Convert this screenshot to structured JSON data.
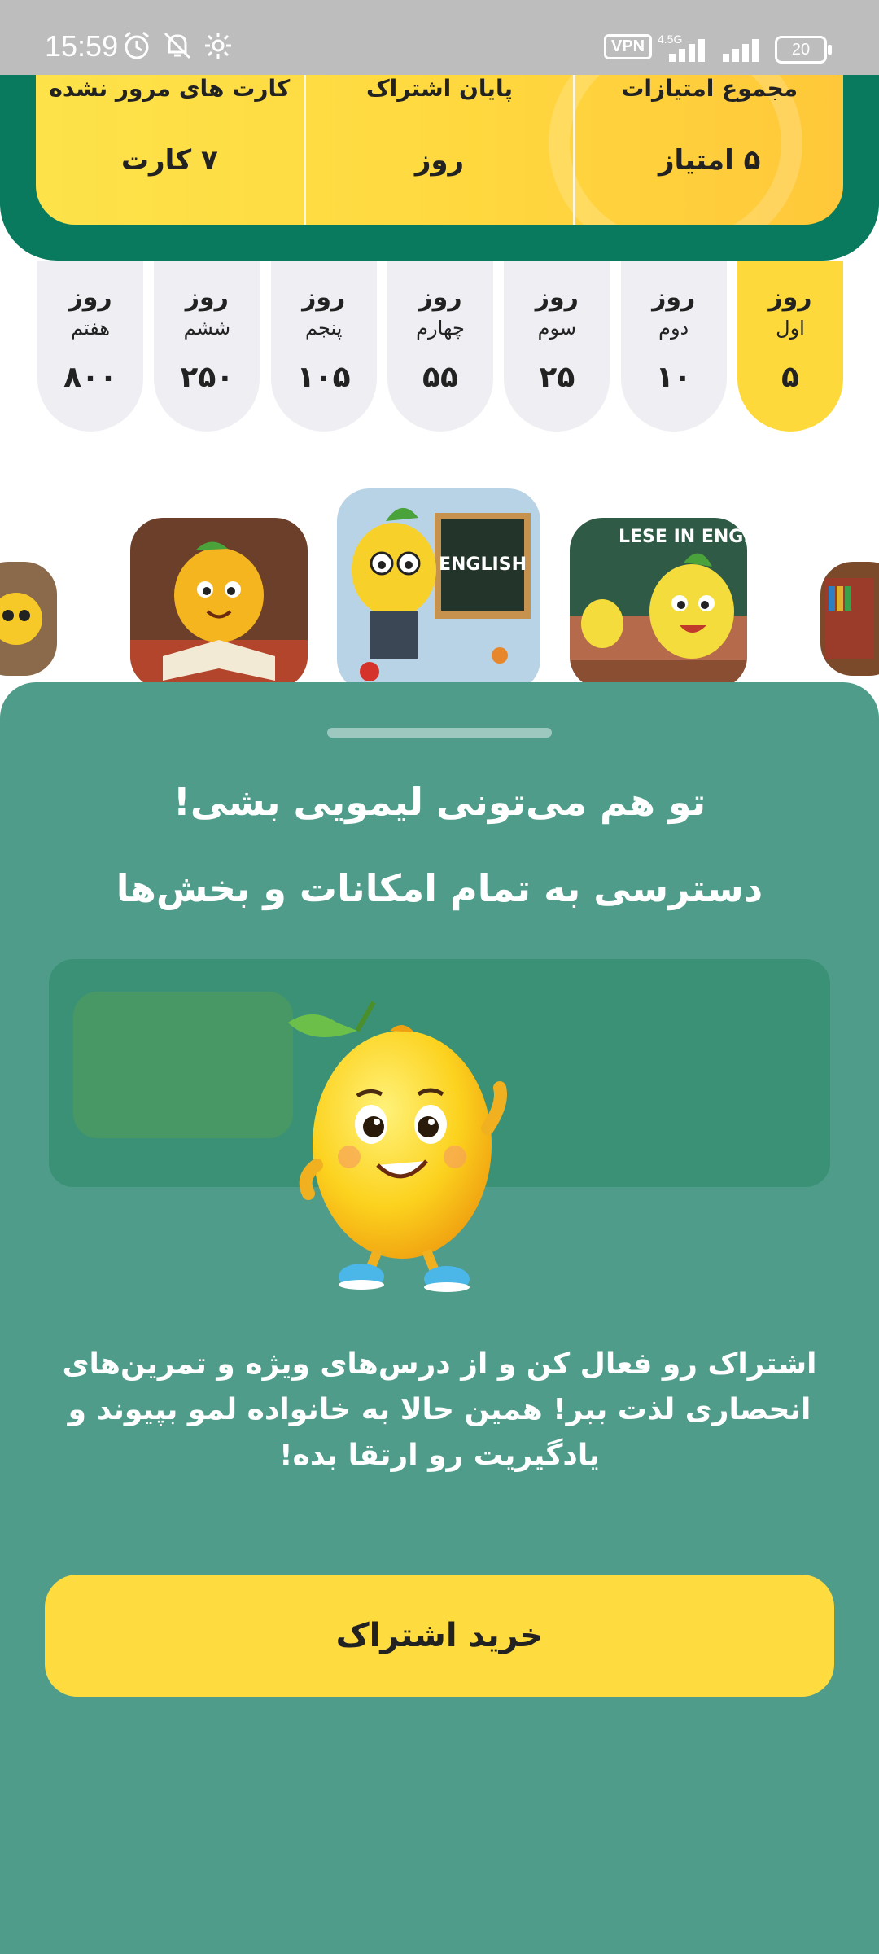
{
  "status_bar": {
    "time": "15:59",
    "vpn_label": "VPN",
    "network_type": "4.5G",
    "battery": "20",
    "icons": [
      "alarm-icon",
      "notifications-off-icon",
      "sync-icon",
      "signal-icon",
      "signal-icon-2",
      "battery-icon"
    ]
  },
  "stats": [
    {
      "label": "مجموع امتیازات",
      "value": "۵ امتیاز"
    },
    {
      "label": "پایان اشتراک",
      "value": "روز"
    },
    {
      "label": "کارت های مرور نشده",
      "value": "۷ کارت"
    }
  ],
  "days": [
    {
      "word": "روز",
      "ordinal": "اول",
      "value": "۵",
      "active": true
    },
    {
      "word": "روز",
      "ordinal": "دوم",
      "value": "۱۰",
      "active": false
    },
    {
      "word": "روز",
      "ordinal": "سوم",
      "value": "۲۵",
      "active": false
    },
    {
      "word": "روز",
      "ordinal": "چهارم",
      "value": "۵۵",
      "active": false
    },
    {
      "word": "روز",
      "ordinal": "پنجم",
      "value": "۱۰۵",
      "active": false
    },
    {
      "word": "روز",
      "ordinal": "ششم",
      "value": "۲۵۰",
      "active": false
    },
    {
      "word": "روز",
      "ordinal": "هفتم",
      "value": "۸۰۰",
      "active": false
    }
  ],
  "carousel": {
    "center_board_text": "ENGLISH",
    "right_board_text": "LESE IN ENGLISH"
  },
  "sheet": {
    "title": "تو هم می‌تونی لیمویی بشی!",
    "subtitle": "دسترسی به تمام امکانات و بخش‌ها",
    "description": "اشتراک رو فعال کن و از درس‌های ویژه و تمرین‌های انحصاری لذت ببر! همین حالا به خانواده لمو بپیوند و یادگیریت رو ارتقا بده!",
    "button_label": "خرید اشتراک"
  },
  "colors": {
    "header_green": "#0a7a5e",
    "accent_yellow": "#fdd93c",
    "sheet_teal": "#4f9c8b",
    "day_inactive": "#efeef3"
  }
}
